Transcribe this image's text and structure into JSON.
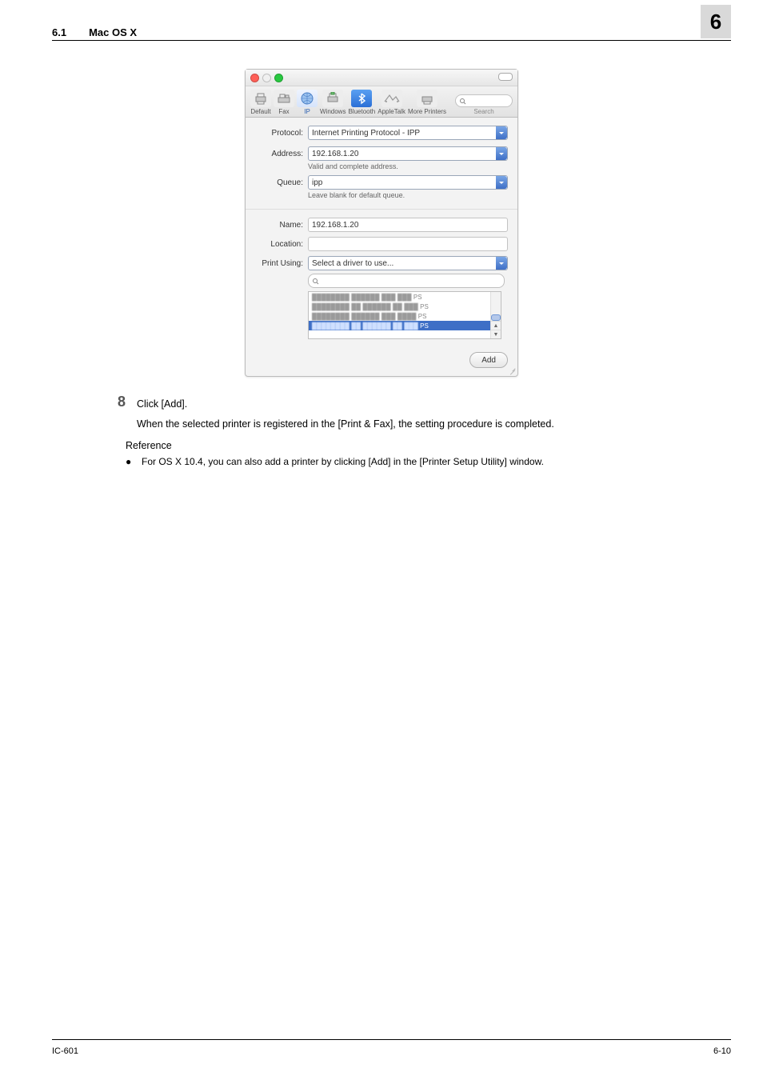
{
  "header": {
    "section_number": "6.1",
    "section_title": "Mac OS X",
    "chapter_number": "6"
  },
  "dialog": {
    "toolbar": {
      "default": "Default",
      "fax": "Fax",
      "ip": "IP",
      "windows": "Windows",
      "bluetooth": "Bluetooth",
      "appletalk": "AppleTalk",
      "more_printers": "More Printers",
      "search": "Search"
    },
    "labels": {
      "protocol": "Protocol:",
      "address": "Address:",
      "queue": "Queue:",
      "name": "Name:",
      "location": "Location:",
      "print_using": "Print Using:"
    },
    "values": {
      "protocol": "Internet Printing Protocol - IPP",
      "address": "192.168.1.20",
      "address_hint": "Valid and complete address.",
      "queue": "ipp",
      "queue_hint": "Leave blank for default queue.",
      "name": "192.168.1.20",
      "location": "",
      "print_using": "Select a driver to use..."
    },
    "driver_rows": {
      "suffix": "PS"
    },
    "add_button": "Add"
  },
  "body": {
    "step_number": "8",
    "step_text": "Click [Add].",
    "step_note": "When the selected printer is registered in the [Print & Fax], the setting procedure is completed.",
    "reference_label": "Reference",
    "bullet1": "For OS X 10.4, you can also add a printer by clicking [Add] in the [Printer Setup Utility] window."
  },
  "footer": {
    "left": "IC-601",
    "right": "6-10"
  }
}
